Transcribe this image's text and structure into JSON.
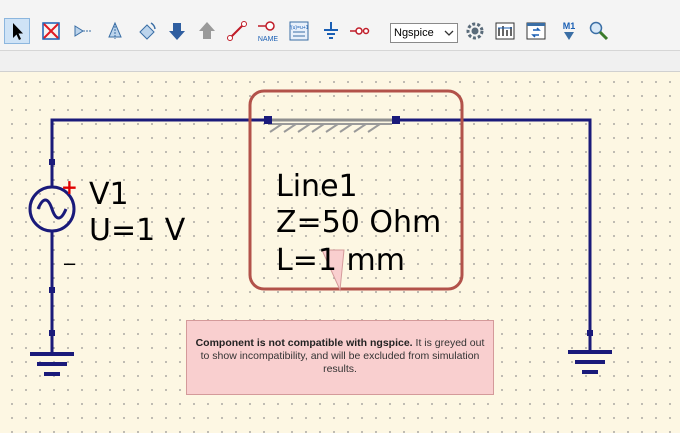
{
  "toolbar": {
    "simulator_select": "Ngspice",
    "marker_label": "M1",
    "wire_label_text": "NAME",
    "equation_text": "f(u)=u+1"
  },
  "schematic": {
    "source": {
      "name": "V1",
      "value": "U=1 V",
      "plus": "+",
      "minus": "−"
    },
    "line": {
      "name": "Line1",
      "impedance": "Z=50 Ohm",
      "length": "L=1 mm"
    }
  },
  "tooltip": {
    "title": "Component is not compatible with ngspice.",
    "message": " It is greyed out to show incompatibility, and will be excluded from simulation results."
  },
  "colors": {
    "wire": "#1a1a7a",
    "highlight": "#b2524a",
    "tooltip_bg": "#f9cfcf",
    "canvas_bg": "#fdf7e3"
  }
}
